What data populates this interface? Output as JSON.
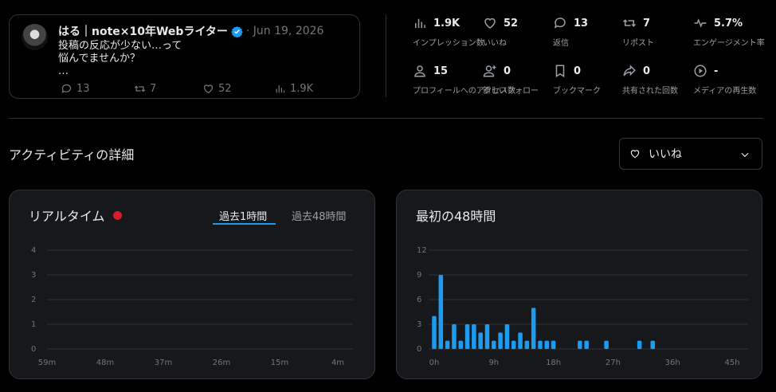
{
  "post": {
    "author": "はる｜note×10年Webライター",
    "date": "· Jun 19, 2026",
    "text_line1": "投稿の反応が少ない…って",
    "text_line2": "悩んでませんか？",
    "text_line3": "…",
    "replies": "13",
    "reposts": "7",
    "likes": "52",
    "views": "1.9K"
  },
  "metrics": [
    {
      "icon": "bar-chart-icon",
      "value": "1.9K",
      "label": "インプレッション数"
    },
    {
      "icon": "heart-icon",
      "value": "52",
      "label": "いいね"
    },
    {
      "icon": "reply-icon",
      "value": "13",
      "label": "返信"
    },
    {
      "icon": "repost-icon",
      "value": "7",
      "label": "リポスト"
    },
    {
      "icon": "pulse-icon",
      "value": "5.7%",
      "label": "エンゲージメント率"
    },
    {
      "icon": "profile-icon",
      "value": "15",
      "label": "プロフィールへのアクセス数"
    },
    {
      "icon": "follow-icon",
      "value": "0",
      "label": "新しいフォロー"
    },
    {
      "icon": "bookmark-icon",
      "value": "0",
      "label": "ブックマーク"
    },
    {
      "icon": "share-icon",
      "value": "0",
      "label": "共有された回数"
    },
    {
      "icon": "play-icon",
      "value": "-",
      "label": "メディアの再生数"
    }
  ],
  "activity": {
    "title": "アクティビティの詳細",
    "dropdown_value": "いいね"
  },
  "realtime": {
    "title": "リアルタイム",
    "tab_active": "過去1時間",
    "tab_inactive": "過去48時間"
  },
  "first48": {
    "title": "最初の48時間"
  },
  "colors": {
    "accent": "#1d9bf0",
    "live": "#f4212e",
    "bar": "#1d9bf0"
  },
  "chart_data": [
    {
      "type": "bar",
      "title": "リアルタイム",
      "x_ticks": [
        "59m",
        "48m",
        "37m",
        "26m",
        "15m",
        "4m"
      ],
      "y_ticks": [
        "0",
        "1",
        "2",
        "3",
        "4"
      ],
      "ylim": [
        0,
        4
      ],
      "values": []
    },
    {
      "type": "bar",
      "title": "最初の48時間",
      "x_ticks": [
        "0h",
        "9h",
        "18h",
        "27h",
        "36h",
        "45h"
      ],
      "y_ticks": [
        "0",
        "3",
        "6",
        "9",
        "12"
      ],
      "ylim": [
        0,
        12
      ],
      "x_range": [
        0,
        45
      ],
      "x": [
        0,
        1,
        2,
        3,
        4,
        5,
        6,
        7,
        8,
        9,
        10,
        11,
        12,
        13,
        14,
        15,
        16,
        17,
        18,
        22,
        23,
        26,
        31,
        33
      ],
      "values": [
        4,
        9,
        1,
        3,
        1,
        3,
        3,
        2,
        3,
        1,
        2,
        3,
        1,
        2,
        1,
        5,
        1,
        1,
        1,
        1,
        1,
        1,
        1,
        1
      ]
    }
  ]
}
